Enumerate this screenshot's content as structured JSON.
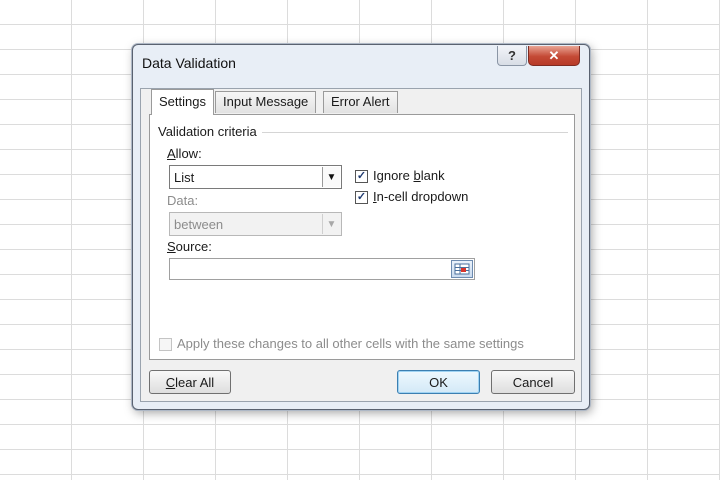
{
  "dialog": {
    "title": "Data Validation",
    "help_symbol": "?",
    "close_symbol": "✕"
  },
  "tabs": [
    {
      "label": "Settings",
      "active": true
    },
    {
      "label": "Input Message",
      "active": false
    },
    {
      "label": "Error Alert",
      "active": false
    }
  ],
  "criteria": {
    "group_label": "Validation criteria",
    "allow_label_accel": "A",
    "allow_label_rest": "llow:",
    "allow_value": "List",
    "data_label": "Data:",
    "data_value": "between",
    "source_label_accel": "S",
    "source_label_rest": "ource:",
    "source_value": ""
  },
  "options": {
    "ignore_blank_pre": "Ignore ",
    "ignore_blank_accel": "b",
    "ignore_blank_post": "lank",
    "ignore_blank_checked": true,
    "in_cell_accel": "I",
    "in_cell_rest": "n-cell dropdown",
    "in_cell_checked": true,
    "apply_all_label": "Apply these changes to all other cells with the same settings",
    "apply_all_checked": false
  },
  "buttons": {
    "clear_all_accel": "C",
    "clear_all_rest": "lear All",
    "ok": "OK",
    "cancel": "Cancel"
  },
  "icons": {
    "dropdown_arrow": "▼",
    "check": "✓"
  }
}
